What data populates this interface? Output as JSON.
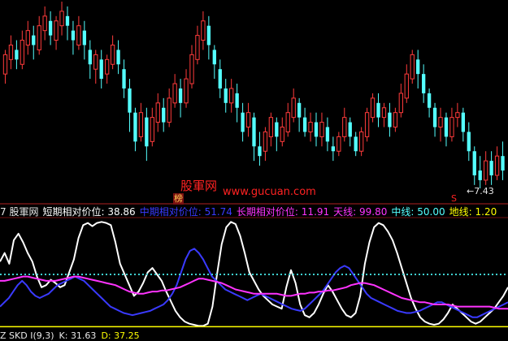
{
  "colors": {
    "background": "#000000",
    "up_candle": "#ff3b3b",
    "down_candle": "#54ffff",
    "white_line": "#ffffff",
    "blue_line": "#3a3aff",
    "magenta_line": "#ff33ff",
    "cyan_dotted": "#3fd0d0",
    "yellow_line": "#ffff00",
    "separator": "#b02020",
    "watermark": "#ff2222"
  },
  "watermark": {
    "cn": "股軍网",
    "url": "www.gucuan.com",
    "badge": "榜"
  },
  "price_label": "←7.43",
  "signal_mark": "S",
  "info_bar": {
    "prefix": "7 股軍网",
    "short_label": "短期相对价位:",
    "short_value": "38.86",
    "mid_label": "中期相对价位:",
    "mid_value": "51.74",
    "long_label": "长期相对价位:",
    "long_value": "11.91",
    "sky_label": "天线:",
    "sky_value": "99.80",
    "center_label": "中线:",
    "center_value": "50.00",
    "ground_label": "地线:",
    "ground_value": "1.20"
  },
  "bottom_bar": {
    "name": "Z SKD I(9,3)",
    "k_label": "K:",
    "k_value": "31.63",
    "d_label": "D:",
    "d_value": "37.25"
  },
  "chart_data": [
    {
      "type": "candlestick",
      "series": [
        {
          "name": "",
          "values": [
            [
              9.8,
              10.2,
              9.6,
              10.3
            ],
            [
              10.1,
              10.4,
              9.9,
              10.6
            ],
            [
              10.3,
              10.1,
              9.9,
              10.5
            ],
            [
              10.0,
              10.5,
              9.9,
              10.7
            ],
            [
              10.4,
              10.7,
              10.2,
              10.9
            ],
            [
              10.6,
              10.4,
              10.1,
              10.8
            ],
            [
              10.3,
              10.8,
              10.2,
              11.0
            ],
            [
              10.7,
              11.0,
              10.5,
              11.2
            ],
            [
              10.9,
              10.6,
              10.4,
              11.1
            ],
            [
              10.5,
              10.9,
              10.3,
              11.0
            ],
            [
              10.8,
              11.1,
              10.6,
              11.3
            ],
            [
              11.0,
              10.8,
              10.5,
              11.2
            ],
            [
              10.7,
              10.5,
              10.2,
              10.9
            ],
            [
              10.4,
              10.8,
              10.3,
              11.0
            ],
            [
              10.7,
              10.4,
              10.1,
              10.9
            ],
            [
              10.3,
              10.0,
              9.7,
              10.5
            ],
            [
              9.9,
              10.2,
              9.6,
              10.3
            ],
            [
              10.1,
              9.7,
              9.5,
              10.3
            ],
            [
              9.8,
              10.1,
              9.6,
              10.2
            ],
            [
              10.0,
              10.4,
              9.9,
              10.6
            ],
            [
              10.3,
              10.0,
              9.8,
              10.5
            ],
            [
              9.9,
              9.5,
              9.3,
              10.1
            ],
            [
              9.5,
              9.0,
              8.6,
              9.7
            ],
            [
              9.0,
              8.4,
              8.2,
              9.1
            ],
            [
              8.5,
              9.0,
              8.4,
              9.2
            ],
            [
              8.9,
              8.3,
              8.0,
              9.1
            ],
            [
              8.4,
              8.9,
              8.3,
              9.1
            ],
            [
              8.8,
              9.2,
              8.6,
              9.4
            ],
            [
              9.1,
              8.8,
              8.6,
              9.3
            ],
            [
              8.8,
              9.3,
              8.7,
              9.5
            ],
            [
              9.2,
              9.6,
              9.1,
              9.8
            ],
            [
              9.5,
              9.2,
              8.9,
              9.7
            ],
            [
              9.2,
              9.7,
              9.1,
              9.9
            ],
            [
              9.6,
              10.2,
              9.5,
              10.4
            ],
            [
              10.1,
              10.6,
              10.0,
              10.8
            ],
            [
              10.5,
              10.9,
              10.3,
              11.1
            ],
            [
              10.8,
              10.4,
              10.1,
              11.0
            ],
            [
              10.3,
              10.0,
              9.7,
              10.4
            ],
            [
              9.9,
              9.5,
              9.3,
              10.1
            ],
            [
              9.5,
              9.2,
              9.0,
              9.7
            ],
            [
              9.2,
              9.5,
              9.0,
              9.7
            ],
            [
              9.4,
              9.1,
              8.8,
              9.6
            ],
            [
              9.0,
              8.6,
              8.4,
              9.2
            ],
            [
              8.7,
              9.0,
              8.5,
              9.2
            ],
            [
              8.9,
              8.3,
              8.0,
              9.0
            ],
            [
              8.3,
              8.1,
              7.9,
              8.6
            ],
            [
              8.2,
              8.6,
              8.0,
              8.7
            ],
            [
              8.5,
              8.9,
              8.3,
              9.0
            ],
            [
              8.8,
              8.5,
              8.2,
              8.9
            ],
            [
              8.4,
              8.7,
              8.3,
              8.9
            ],
            [
              8.6,
              9.0,
              8.5,
              9.2
            ],
            [
              8.9,
              9.3,
              8.8,
              9.5
            ],
            [
              9.2,
              8.9,
              8.6,
              9.3
            ],
            [
              8.9,
              8.6,
              8.5,
              9.1
            ],
            [
              8.6,
              8.8,
              8.4,
              9.0
            ],
            [
              8.8,
              8.5,
              8.3,
              9.0
            ],
            [
              8.5,
              8.8,
              8.3,
              9.0
            ],
            [
              8.7,
              8.4,
              8.2,
              8.9
            ],
            [
              8.3,
              8.2,
              8.0,
              8.5
            ],
            [
              8.2,
              8.5,
              8.1,
              8.6
            ],
            [
              8.5,
              8.9,
              8.4,
              9.1
            ],
            [
              8.8,
              8.5,
              8.3,
              8.9
            ],
            [
              8.5,
              8.2,
              8.1,
              8.6
            ],
            [
              8.2,
              8.6,
              8.1,
              8.7
            ],
            [
              8.5,
              9.0,
              8.4,
              9.1
            ],
            [
              8.9,
              9.3,
              8.8,
              9.4
            ],
            [
              9.2,
              8.9,
              8.7,
              9.4
            ],
            [
              8.9,
              9.1,
              8.7,
              9.2
            ],
            [
              9.0,
              8.7,
              8.5,
              9.2
            ],
            [
              8.7,
              9.0,
              8.6,
              9.1
            ],
            [
              9.0,
              9.4,
              8.9,
              9.6
            ],
            [
              9.3,
              9.8,
              9.2,
              10.0
            ],
            [
              9.7,
              10.2,
              9.6,
              10.3
            ],
            [
              10.1,
              9.8,
              9.5,
              10.3
            ],
            [
              9.8,
              9.4,
              9.2,
              10.0
            ],
            [
              9.4,
              9.1,
              8.9,
              9.5
            ],
            [
              9.1,
              8.7,
              8.5,
              9.2
            ],
            [
              8.7,
              8.9,
              8.4,
              9.1
            ],
            [
              8.9,
              8.5,
              8.3,
              9.0
            ],
            [
              8.5,
              8.9,
              8.4,
              9.1
            ],
            [
              8.9,
              9.0,
              8.7,
              9.2
            ],
            [
              9.0,
              8.6,
              8.4,
              9.1
            ],
            [
              8.6,
              8.2,
              8.0,
              8.8
            ],
            [
              8.2,
              7.7,
              7.5,
              8.3
            ],
            [
              7.8,
              7.6,
              7.43,
              8.1
            ],
            [
              7.6,
              8.0,
              7.5,
              8.2
            ],
            [
              8.0,
              7.7,
              7.5,
              8.2
            ],
            [
              7.7,
              8.1,
              7.6,
              8.3
            ],
            [
              8.1,
              7.8,
              7.6,
              8.4
            ]
          ]
        }
      ]
    },
    {
      "type": "line",
      "series": [
        {
          "name": "短期相对价位",
          "values": [
            62,
            70,
            60,
            82,
            88,
            80,
            70,
            62,
            48,
            38,
            40,
            45,
            42,
            38,
            40,
            52,
            64,
            84,
            96,
            98,
            95,
            98,
            99,
            98,
            96,
            80,
            60,
            50,
            40,
            30,
            34,
            42,
            52,
            56,
            50,
            44,
            34,
            25,
            16,
            10,
            6,
            4,
            3,
            2,
            2,
            4,
            20,
            50,
            78,
            94,
            99,
            97,
            86,
            70,
            52,
            44,
            36,
            30,
            26,
            22,
            20,
            18,
            38,
            54,
            42,
            22,
            12,
            10,
            14,
            22,
            32,
            40,
            34,
            26,
            18,
            12,
            10,
            14,
            30,
            60,
            80,
            94,
            98,
            96,
            90,
            82,
            70,
            56,
            42,
            28,
            18,
            10,
            6,
            4,
            3,
            4,
            8,
            14,
            22,
            18,
            14,
            10,
            6,
            4,
            6,
            10,
            14,
            18,
            24,
            30,
            38
          ]
        },
        {
          "name": "中期相对价位",
          "values": [
            20,
            24,
            28,
            34,
            40,
            44,
            40,
            34,
            30,
            28,
            30,
            32,
            36,
            40,
            42,
            44,
            46,
            48,
            46,
            44,
            40,
            36,
            32,
            28,
            24,
            20,
            18,
            16,
            14,
            13,
            12,
            13,
            14,
            15,
            16,
            18,
            20,
            22,
            26,
            32,
            40,
            52,
            64,
            72,
            74,
            70,
            64,
            56,
            48,
            44,
            40,
            36,
            34,
            32,
            30,
            28,
            26,
            28,
            30,
            32,
            30,
            28,
            26,
            24,
            22,
            20,
            18,
            17,
            16,
            18,
            22,
            26,
            30,
            34,
            40,
            46,
            52,
            56,
            58,
            56,
            50,
            44,
            38,
            32,
            28,
            26,
            24,
            22,
            20,
            18,
            16,
            15,
            14,
            14,
            15,
            16,
            18,
            20,
            22,
            24,
            24,
            22,
            20,
            18,
            16,
            14,
            12,
            10,
            10,
            12,
            14,
            16,
            18,
            20,
            22,
            24
          ]
        },
        {
          "name": "长期相对价位",
          "values": [
            44,
            44,
            45,
            46,
            47,
            48,
            48,
            47,
            46,
            45,
            44,
            44,
            44,
            45,
            46,
            47,
            48,
            48,
            47,
            46,
            45,
            44,
            43,
            42,
            41,
            40,
            38,
            36,
            34,
            33,
            32,
            32,
            33,
            34,
            34,
            35,
            35,
            36,
            37,
            38,
            40,
            42,
            44,
            46,
            46,
            45,
            44,
            43,
            42,
            40,
            38,
            36,
            35,
            34,
            33,
            32,
            32,
            32,
            32,
            32,
            32,
            31,
            30,
            30,
            31,
            32,
            32,
            33,
            33,
            34,
            34,
            35,
            35,
            36,
            37,
            38,
            40,
            41,
            42,
            42,
            41,
            40,
            38,
            36,
            34,
            32,
            30,
            28,
            27,
            26,
            25,
            24,
            24,
            23,
            22,
            22,
            22,
            22,
            21,
            20,
            20,
            20,
            20,
            20,
            20,
            20,
            20,
            19,
            18,
            18,
            18
          ]
        },
        {
          "name": "中线",
          "values": [
            50
          ]
        },
        {
          "name": "地线",
          "values": [
            1.2
          ]
        }
      ],
      "ylim": [
        0,
        100
      ]
    }
  ]
}
